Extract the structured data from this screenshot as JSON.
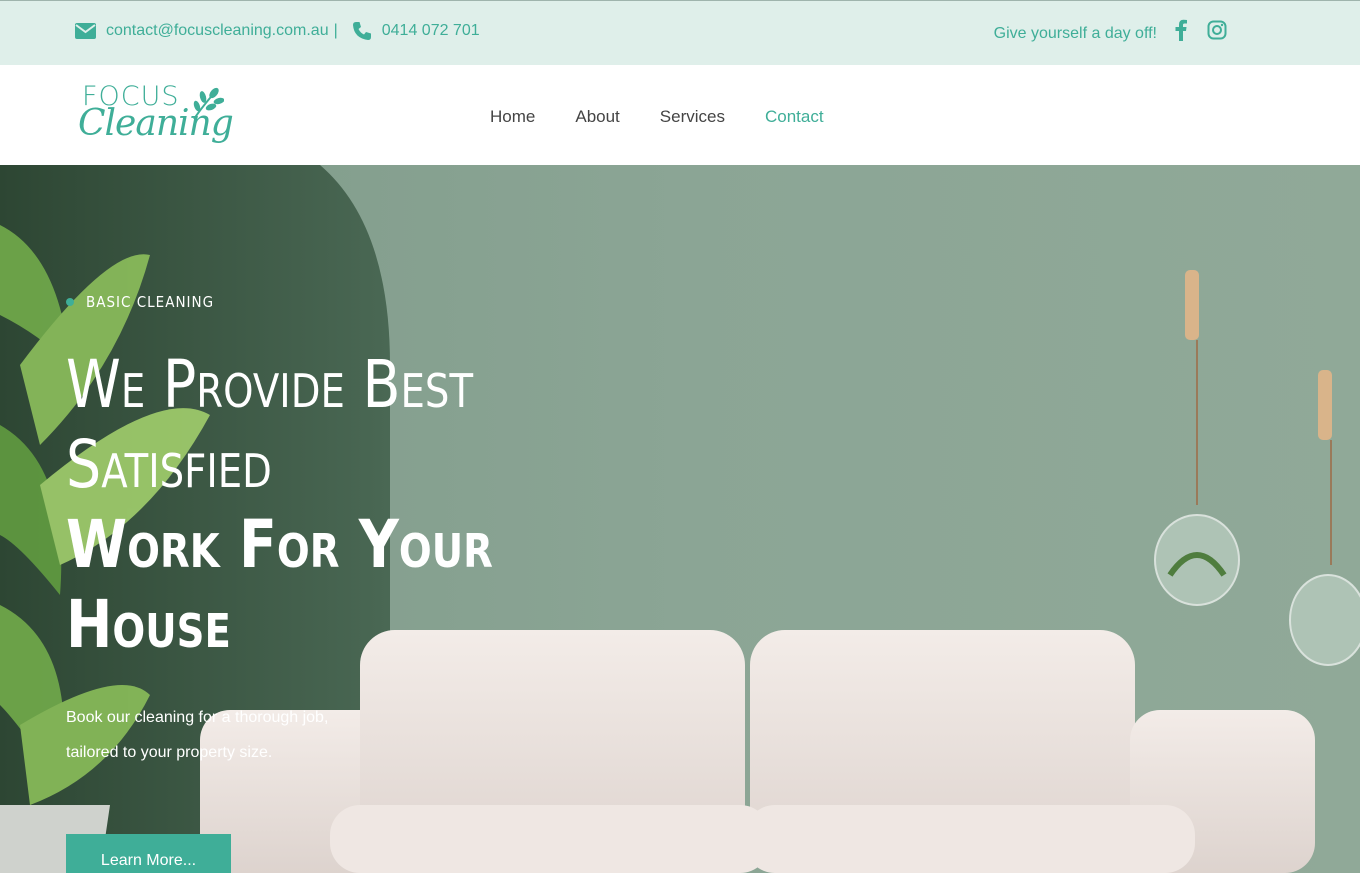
{
  "topbar": {
    "email": "contact@focuscleaning.com.au",
    "separator": "|",
    "phone": "0414 072 701",
    "tagline": "Give yourself a day off!",
    "icons": [
      "envelope-icon",
      "phone-icon",
      "facebook-icon",
      "instagram-icon"
    ]
  },
  "logo": {
    "line1": "FOCUS",
    "line2": "Cleaning"
  },
  "nav": {
    "items": [
      {
        "label": "Home"
      },
      {
        "label": "About"
      },
      {
        "label": "Services"
      },
      {
        "label": "Contact"
      }
    ],
    "active": "Contact"
  },
  "hero": {
    "tag": "BASIC CLEANING",
    "headline_light_1": "We Provide Best",
    "headline_light_2": "Satisfied",
    "headline_bold_1": "Work For Your",
    "headline_bold_2": "House",
    "desc_line1": "Book our cleaning for a thorough job,",
    "desc_line2": "tailored to your property size.",
    "button": "Learn More..."
  },
  "colors": {
    "accent": "#3fae98",
    "topbar_bg": "#dfefea",
    "wall": "#8ca696",
    "nav_text": "#444444"
  }
}
